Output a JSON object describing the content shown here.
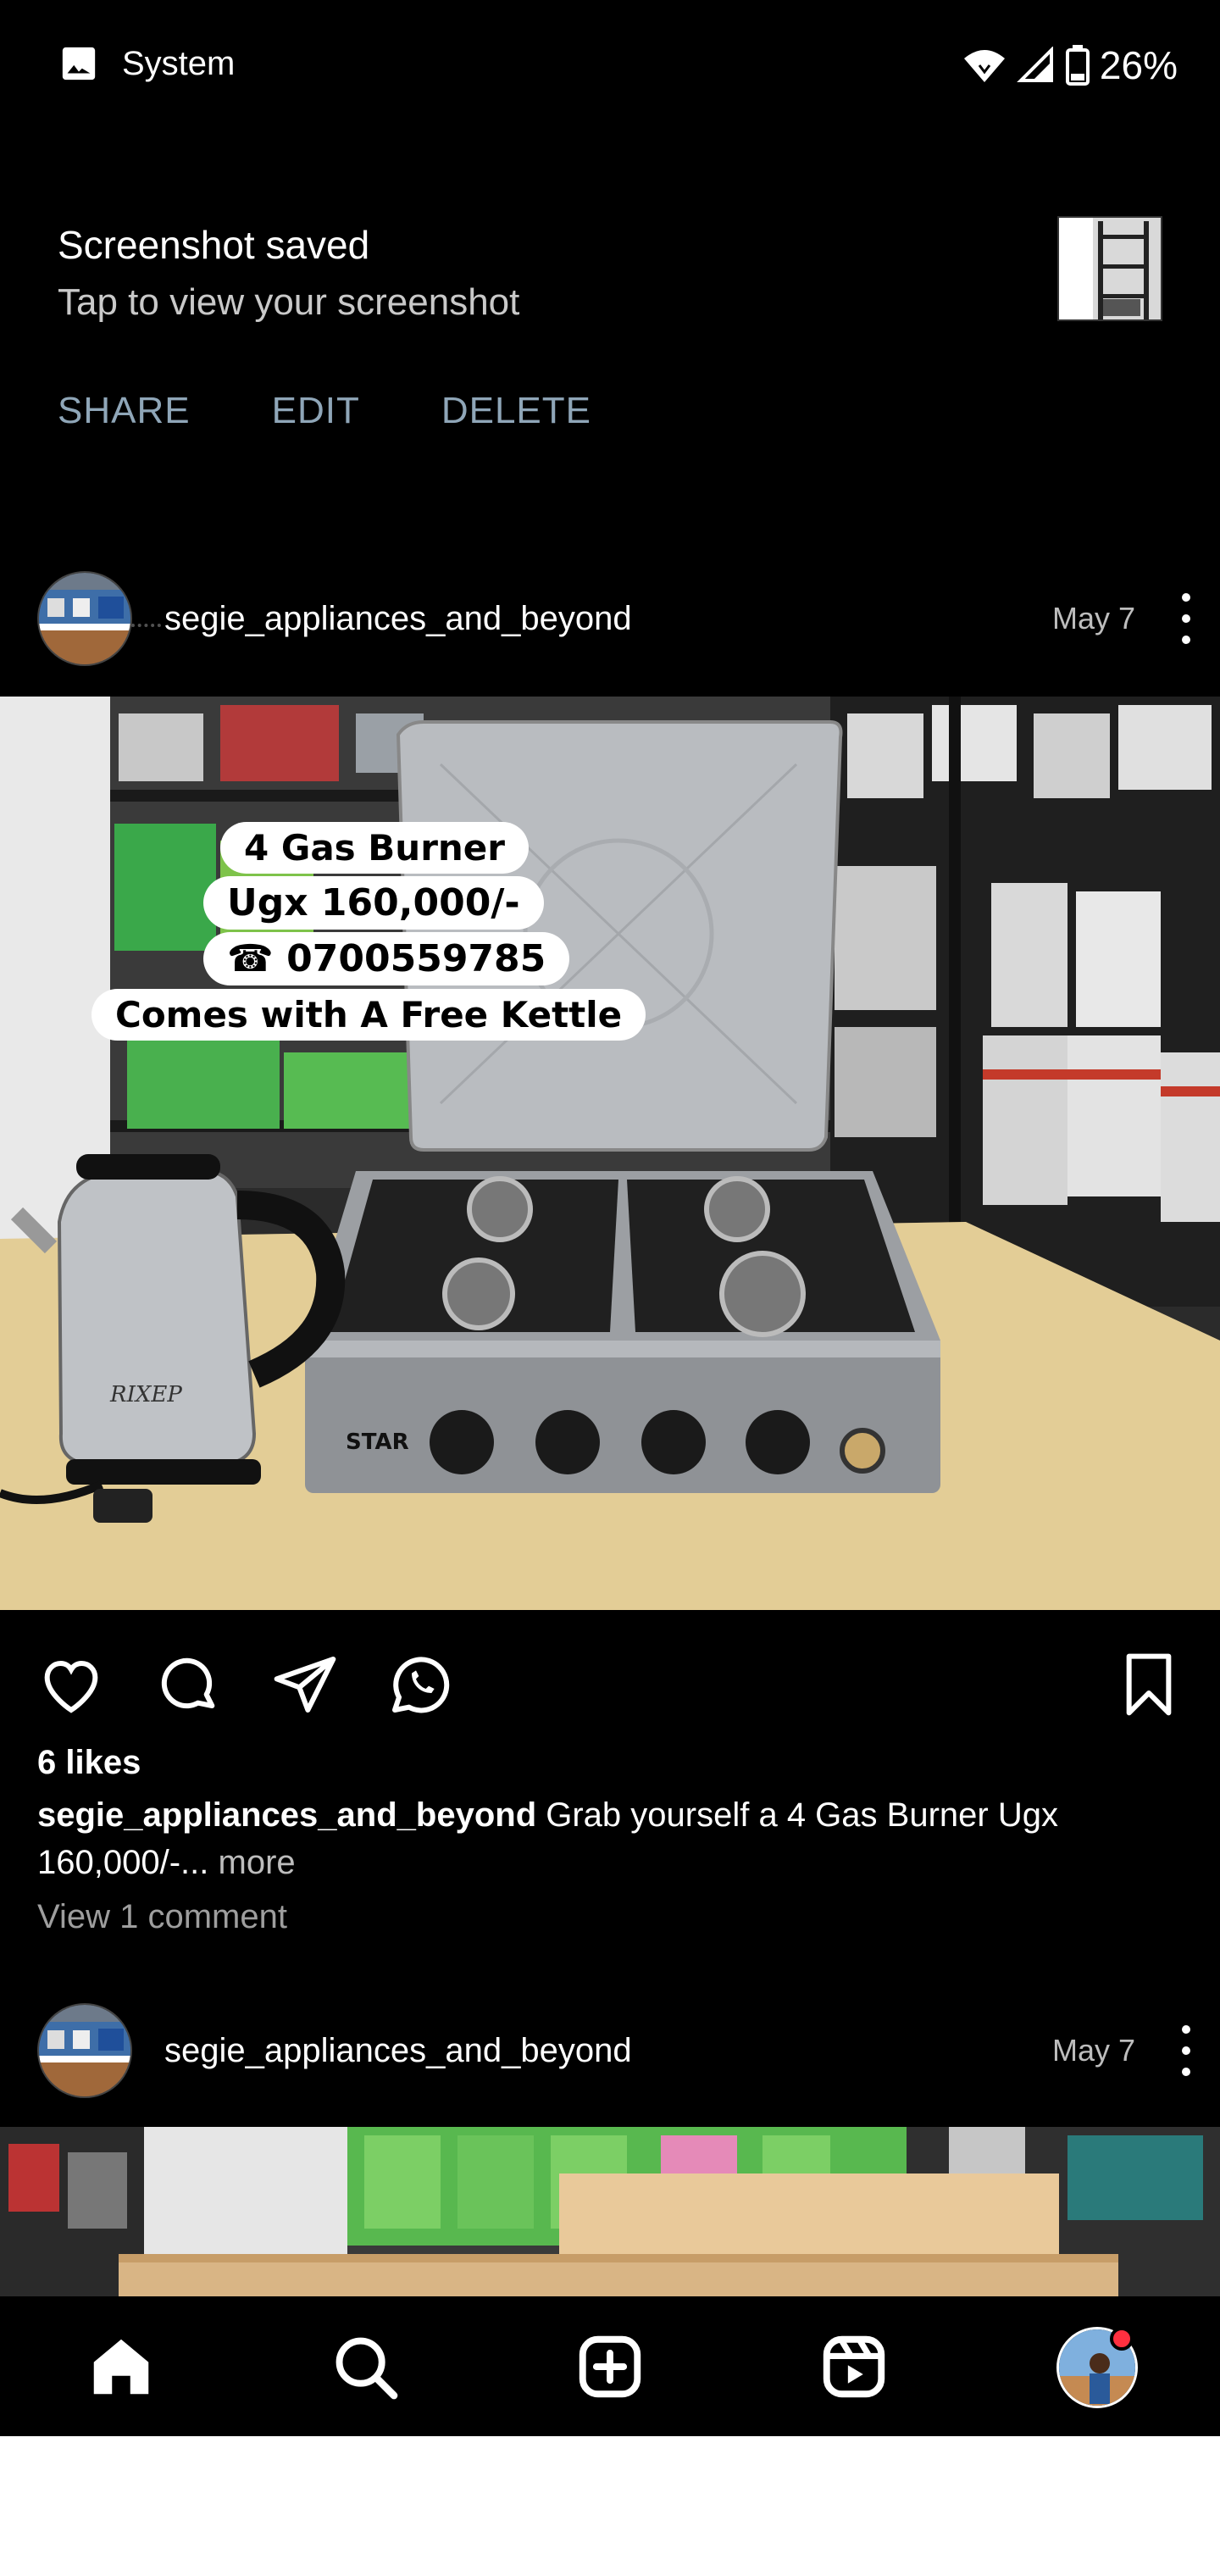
{
  "status_bar": {
    "notification_source": "System",
    "battery": "26%",
    "icons": [
      "image-icon",
      "wifi-icon",
      "signal-icon",
      "battery-icon"
    ]
  },
  "notification": {
    "title": "Screenshot saved",
    "subtitle": "Tap to view your screenshot",
    "actions": {
      "share": "SHARE",
      "edit": "EDIT",
      "delete": "DELETE"
    }
  },
  "posts": [
    {
      "username": "segie_appliances_and_beyond",
      "date": "May 7",
      "overlay": {
        "line1": "4 Gas Burner",
        "line2": "Ugx 160,000/-",
        "line3": "☎ 0700559785",
        "line4": "Comes with A Free Kettle"
      },
      "image_text": {
        "kettle_brand": "RIXEP",
        "stove_brand": "STAR"
      },
      "likes": "6 likes",
      "caption_user": "segie_appliances_and_beyond",
      "caption_text": "Grab yourself a 4 Gas Burner Ugx 160,000/-...",
      "caption_more": "more",
      "view_comments": "View 1 comment"
    },
    {
      "username": "segie_appliances_and_beyond",
      "date": "May 7"
    }
  ],
  "colors": {
    "background": "#000000",
    "action_text": "#8fa6b8",
    "notification_badge": "#ff3040"
  },
  "nav": [
    "home-icon",
    "search-icon",
    "create-icon",
    "reels-icon",
    "profile-avatar"
  ]
}
